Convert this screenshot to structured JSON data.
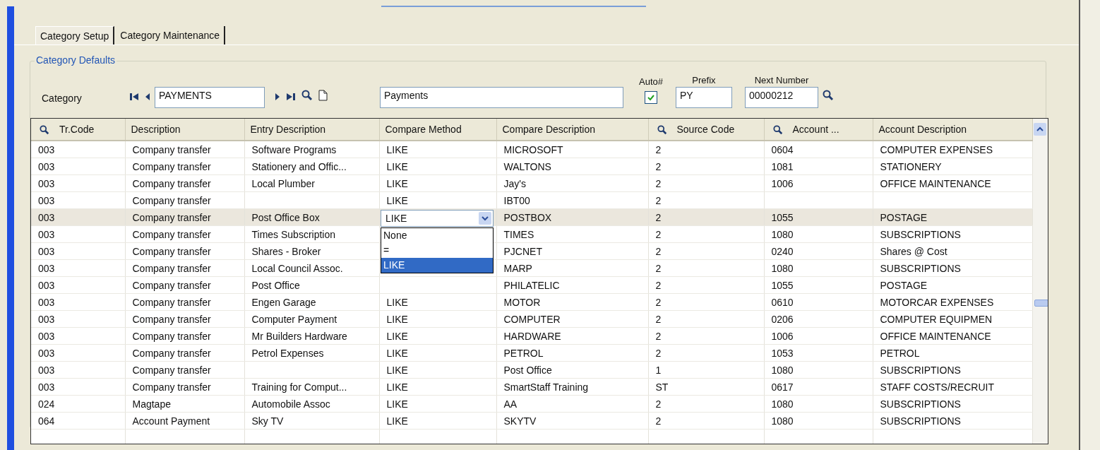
{
  "tabs": [
    {
      "label": "Category Setup",
      "selected": true
    },
    {
      "label": "Category Maintenance",
      "selected": false
    }
  ],
  "group": {
    "title": "Category Defaults",
    "category_label": "Category",
    "category_code": "PAYMENTS",
    "category_name": "Payments",
    "auto_number": {
      "label": "Auto#",
      "checked": true
    },
    "prefix": {
      "label": "Prefix",
      "value": "PY"
    },
    "next_number": {
      "label": "Next Number",
      "value": "00000212"
    }
  },
  "table": {
    "columns": [
      {
        "label": "Tr.Code",
        "search": true
      },
      {
        "label": "Description",
        "search": false
      },
      {
        "label": "Entry Description",
        "search": false
      },
      {
        "label": "Compare Method",
        "search": false
      },
      {
        "label": "Compare Description",
        "search": false
      },
      {
        "label": "Source Code",
        "search": true
      },
      {
        "label": "Account ...",
        "search": true
      },
      {
        "label": "Account Description",
        "search": false
      }
    ],
    "rows": [
      {
        "selected": false,
        "cells": [
          "003",
          "Company transfer",
          "Software Programs",
          "LIKE",
          "MICROSOFT",
          "2",
          "0604",
          "COMPUTER EXPENSES"
        ]
      },
      {
        "selected": false,
        "cells": [
          "003",
          "Company transfer",
          "Stationery and Offic...",
          "LIKE",
          "WALTONS",
          "2",
          "1081",
          "STATIONERY"
        ]
      },
      {
        "selected": false,
        "cells": [
          "003",
          "Company transfer",
          "Local Plumber",
          "LIKE",
          "Jay's",
          "2",
          "1006",
          "OFFICE MAINTENANCE"
        ]
      },
      {
        "selected": false,
        "cells": [
          "003",
          "Company transfer",
          "",
          "LIKE",
          "IBT00",
          "2",
          "",
          ""
        ]
      },
      {
        "selected": true,
        "cells": [
          "003",
          "Company transfer",
          "Post Office Box",
          "",
          "POSTBOX",
          "2",
          "1055",
          "POSTAGE"
        ]
      },
      {
        "selected": false,
        "cells": [
          "003",
          "Company transfer",
          "Times Subscription",
          "",
          "TIMES",
          "2",
          "1080",
          "SUBSCRIPTIONS"
        ]
      },
      {
        "selected": false,
        "cells": [
          "003",
          "Company transfer",
          "Shares - Broker",
          "",
          "PJCNET",
          "2",
          "0240",
          "Shares @ Cost"
        ]
      },
      {
        "selected": false,
        "cells": [
          "003",
          "Company transfer",
          "Local Council Assoc.",
          "",
          "MARP",
          "2",
          "1080",
          "SUBSCRIPTIONS"
        ]
      },
      {
        "selected": false,
        "cells": [
          "003",
          "Company transfer",
          "Post Office",
          "",
          "PHILATELIC",
          "2",
          "1055",
          "POSTAGE"
        ]
      },
      {
        "selected": false,
        "cells": [
          "003",
          "Company transfer",
          "Engen Garage",
          "LIKE",
          "MOTOR",
          "2",
          "0610",
          "MOTORCAR EXPENSES"
        ]
      },
      {
        "selected": false,
        "cells": [
          "003",
          "Company transfer",
          "Computer Payment",
          "LIKE",
          "COMPUTER",
          "2",
          "0206",
          "COMPUTER EQUIPMEN"
        ]
      },
      {
        "selected": false,
        "cells": [
          "003",
          "Company transfer",
          "Mr Builders Hardware",
          "LIKE",
          "HARDWARE",
          "2",
          "1006",
          "OFFICE MAINTENANCE"
        ]
      },
      {
        "selected": false,
        "cells": [
          "003",
          "Company transfer",
          "Petrol Expenses",
          "LIKE",
          "PETROL",
          "2",
          "1053",
          "PETROL"
        ]
      },
      {
        "selected": false,
        "cells": [
          "003",
          "Company transfer",
          "",
          "LIKE",
          "Post Office",
          "1",
          "1080",
          "SUBSCRIPTIONS"
        ]
      },
      {
        "selected": false,
        "cells": [
          "003",
          "Company transfer",
          "Training for Comput...",
          "LIKE",
          "SmartStaff Training",
          "ST",
          "0617",
          "STAFF COSTS/RECRUIT"
        ]
      },
      {
        "selected": false,
        "cells": [
          "024",
          "Magtape",
          "Automobile Assoc",
          "LIKE",
          "AA",
          "2",
          "1080",
          "SUBSCRIPTIONS"
        ]
      },
      {
        "selected": false,
        "cells": [
          "064",
          "Account Payment",
          "Sky TV",
          "LIKE",
          "SKYTV",
          "2",
          "1080",
          "SUBSCRIPTIONS"
        ]
      }
    ],
    "editor": {
      "value": "LIKE",
      "options": [
        {
          "label": "None",
          "selected": false
        },
        {
          "label": "=",
          "selected": false
        },
        {
          "label": "LIKE",
          "selected": true
        }
      ]
    }
  }
}
